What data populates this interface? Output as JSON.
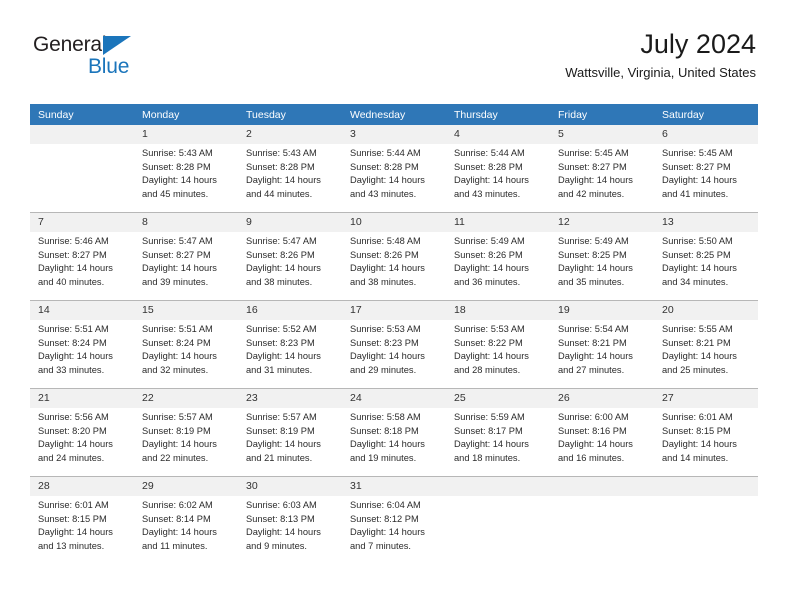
{
  "brand": {
    "name_part1": "General",
    "name_part2": "Blue"
  },
  "header": {
    "month_title": "July 2024",
    "location": "Wattsville, Virginia, United States"
  },
  "theme": {
    "header_blue": "#2f77b7",
    "daynum_gray": "#f1f1f1",
    "brand_blue": "#1b75bb",
    "grid_line": "#b7b7b7"
  },
  "weekdays": [
    "Sunday",
    "Monday",
    "Tuesday",
    "Wednesday",
    "Thursday",
    "Friday",
    "Saturday"
  ],
  "weeks": [
    [
      {
        "day": "",
        "blank": true,
        "sunrise": "",
        "sunset": "",
        "daylight1": "",
        "daylight2": ""
      },
      {
        "day": "1",
        "sunrise": "Sunrise: 5:43 AM",
        "sunset": "Sunset: 8:28 PM",
        "daylight1": "Daylight: 14 hours",
        "daylight2": "and 45 minutes."
      },
      {
        "day": "2",
        "sunrise": "Sunrise: 5:43 AM",
        "sunset": "Sunset: 8:28 PM",
        "daylight1": "Daylight: 14 hours",
        "daylight2": "and 44 minutes."
      },
      {
        "day": "3",
        "sunrise": "Sunrise: 5:44 AM",
        "sunset": "Sunset: 8:28 PM",
        "daylight1": "Daylight: 14 hours",
        "daylight2": "and 43 minutes."
      },
      {
        "day": "4",
        "sunrise": "Sunrise: 5:44 AM",
        "sunset": "Sunset: 8:28 PM",
        "daylight1": "Daylight: 14 hours",
        "daylight2": "and 43 minutes."
      },
      {
        "day": "5",
        "sunrise": "Sunrise: 5:45 AM",
        "sunset": "Sunset: 8:27 PM",
        "daylight1": "Daylight: 14 hours",
        "daylight2": "and 42 minutes."
      },
      {
        "day": "6",
        "sunrise": "Sunrise: 5:45 AM",
        "sunset": "Sunset: 8:27 PM",
        "daylight1": "Daylight: 14 hours",
        "daylight2": "and 41 minutes."
      }
    ],
    [
      {
        "day": "7",
        "sunrise": "Sunrise: 5:46 AM",
        "sunset": "Sunset: 8:27 PM",
        "daylight1": "Daylight: 14 hours",
        "daylight2": "and 40 minutes."
      },
      {
        "day": "8",
        "sunrise": "Sunrise: 5:47 AM",
        "sunset": "Sunset: 8:27 PM",
        "daylight1": "Daylight: 14 hours",
        "daylight2": "and 39 minutes."
      },
      {
        "day": "9",
        "sunrise": "Sunrise: 5:47 AM",
        "sunset": "Sunset: 8:26 PM",
        "daylight1": "Daylight: 14 hours",
        "daylight2": "and 38 minutes."
      },
      {
        "day": "10",
        "sunrise": "Sunrise: 5:48 AM",
        "sunset": "Sunset: 8:26 PM",
        "daylight1": "Daylight: 14 hours",
        "daylight2": "and 38 minutes."
      },
      {
        "day": "11",
        "sunrise": "Sunrise: 5:49 AM",
        "sunset": "Sunset: 8:26 PM",
        "daylight1": "Daylight: 14 hours",
        "daylight2": "and 36 minutes."
      },
      {
        "day": "12",
        "sunrise": "Sunrise: 5:49 AM",
        "sunset": "Sunset: 8:25 PM",
        "daylight1": "Daylight: 14 hours",
        "daylight2": "and 35 minutes."
      },
      {
        "day": "13",
        "sunrise": "Sunrise: 5:50 AM",
        "sunset": "Sunset: 8:25 PM",
        "daylight1": "Daylight: 14 hours",
        "daylight2": "and 34 minutes."
      }
    ],
    [
      {
        "day": "14",
        "sunrise": "Sunrise: 5:51 AM",
        "sunset": "Sunset: 8:24 PM",
        "daylight1": "Daylight: 14 hours",
        "daylight2": "and 33 minutes."
      },
      {
        "day": "15",
        "sunrise": "Sunrise: 5:51 AM",
        "sunset": "Sunset: 8:24 PM",
        "daylight1": "Daylight: 14 hours",
        "daylight2": "and 32 minutes."
      },
      {
        "day": "16",
        "sunrise": "Sunrise: 5:52 AM",
        "sunset": "Sunset: 8:23 PM",
        "daylight1": "Daylight: 14 hours",
        "daylight2": "and 31 minutes."
      },
      {
        "day": "17",
        "sunrise": "Sunrise: 5:53 AM",
        "sunset": "Sunset: 8:23 PM",
        "daylight1": "Daylight: 14 hours",
        "daylight2": "and 29 minutes."
      },
      {
        "day": "18",
        "sunrise": "Sunrise: 5:53 AM",
        "sunset": "Sunset: 8:22 PM",
        "daylight1": "Daylight: 14 hours",
        "daylight2": "and 28 minutes."
      },
      {
        "day": "19",
        "sunrise": "Sunrise: 5:54 AM",
        "sunset": "Sunset: 8:21 PM",
        "daylight1": "Daylight: 14 hours",
        "daylight2": "and 27 minutes."
      },
      {
        "day": "20",
        "sunrise": "Sunrise: 5:55 AM",
        "sunset": "Sunset: 8:21 PM",
        "daylight1": "Daylight: 14 hours",
        "daylight2": "and 25 minutes."
      }
    ],
    [
      {
        "day": "21",
        "sunrise": "Sunrise: 5:56 AM",
        "sunset": "Sunset: 8:20 PM",
        "daylight1": "Daylight: 14 hours",
        "daylight2": "and 24 minutes."
      },
      {
        "day": "22",
        "sunrise": "Sunrise: 5:57 AM",
        "sunset": "Sunset: 8:19 PM",
        "daylight1": "Daylight: 14 hours",
        "daylight2": "and 22 minutes."
      },
      {
        "day": "23",
        "sunrise": "Sunrise: 5:57 AM",
        "sunset": "Sunset: 8:19 PM",
        "daylight1": "Daylight: 14 hours",
        "daylight2": "and 21 minutes."
      },
      {
        "day": "24",
        "sunrise": "Sunrise: 5:58 AM",
        "sunset": "Sunset: 8:18 PM",
        "daylight1": "Daylight: 14 hours",
        "daylight2": "and 19 minutes."
      },
      {
        "day": "25",
        "sunrise": "Sunrise: 5:59 AM",
        "sunset": "Sunset: 8:17 PM",
        "daylight1": "Daylight: 14 hours",
        "daylight2": "and 18 minutes."
      },
      {
        "day": "26",
        "sunrise": "Sunrise: 6:00 AM",
        "sunset": "Sunset: 8:16 PM",
        "daylight1": "Daylight: 14 hours",
        "daylight2": "and 16 minutes."
      },
      {
        "day": "27",
        "sunrise": "Sunrise: 6:01 AM",
        "sunset": "Sunset: 8:15 PM",
        "daylight1": "Daylight: 14 hours",
        "daylight2": "and 14 minutes."
      }
    ],
    [
      {
        "day": "28",
        "sunrise": "Sunrise: 6:01 AM",
        "sunset": "Sunset: 8:15 PM",
        "daylight1": "Daylight: 14 hours",
        "daylight2": "and 13 minutes."
      },
      {
        "day": "29",
        "sunrise": "Sunrise: 6:02 AM",
        "sunset": "Sunset: 8:14 PM",
        "daylight1": "Daylight: 14 hours",
        "daylight2": "and 11 minutes."
      },
      {
        "day": "30",
        "sunrise": "Sunrise: 6:03 AM",
        "sunset": "Sunset: 8:13 PM",
        "daylight1": "Daylight: 14 hours",
        "daylight2": "and 9 minutes."
      },
      {
        "day": "31",
        "sunrise": "Sunrise: 6:04 AM",
        "sunset": "Sunset: 8:12 PM",
        "daylight1": "Daylight: 14 hours",
        "daylight2": "and 7 minutes."
      },
      {
        "day": "",
        "blank": true,
        "sunrise": "",
        "sunset": "",
        "daylight1": "",
        "daylight2": ""
      },
      {
        "day": "",
        "blank": true,
        "sunrise": "",
        "sunset": "",
        "daylight1": "",
        "daylight2": ""
      },
      {
        "day": "",
        "blank": true,
        "sunrise": "",
        "sunset": "",
        "daylight1": "",
        "daylight2": ""
      }
    ]
  ]
}
